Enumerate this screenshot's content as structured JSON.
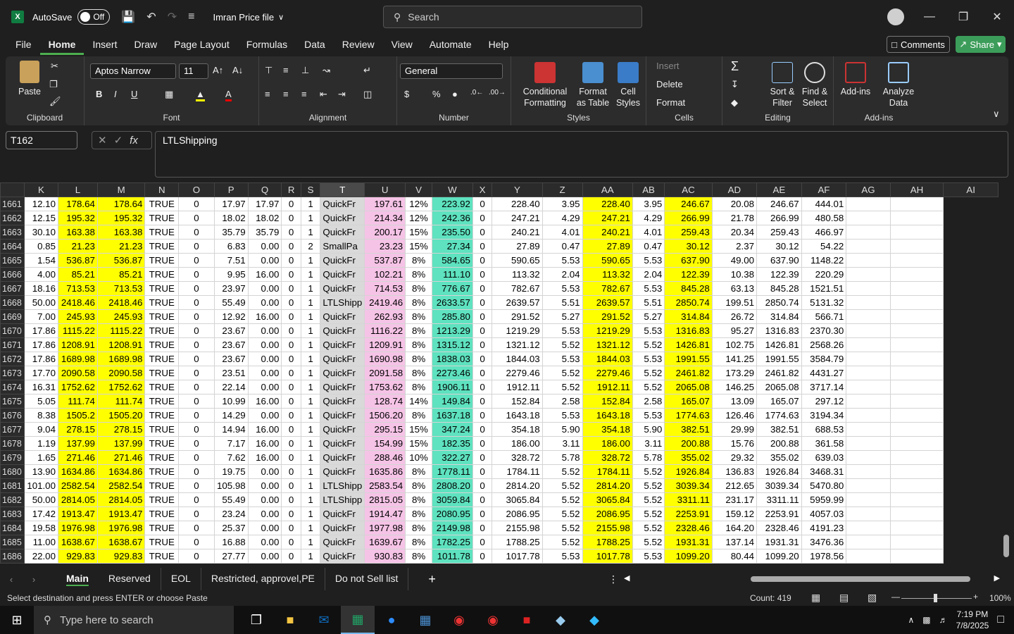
{
  "titlebar": {
    "autosave_label": "AutoSave",
    "toggle_state": "Off",
    "filename": "Imran Price file",
    "search_placeholder": "Search"
  },
  "menu": {
    "tabs": [
      "File",
      "Home",
      "Insert",
      "Draw",
      "Page Layout",
      "Formulas",
      "Data",
      "Review",
      "View",
      "Automate",
      "Help"
    ],
    "active": "Home",
    "comments": "Comments",
    "share": "Share"
  },
  "ribbon": {
    "clipboard": {
      "paste": "Paste",
      "label": "Clipboard"
    },
    "font": {
      "name": "Aptos Narrow",
      "size": "11",
      "label": "Font"
    },
    "alignment": {
      "label": "Alignment"
    },
    "number": {
      "format": "General",
      "label": "Number"
    },
    "styles": {
      "conditional": "Conditional Formatting",
      "format_table": "Format as Table",
      "cell_styles": "Cell Styles",
      "label": "Styles"
    },
    "cells": {
      "insert": "Insert",
      "delete": "Delete",
      "format": "Format",
      "label": "Cells"
    },
    "editing": {
      "sort": "Sort & Filter",
      "find": "Find & Select",
      "label": "Editing"
    },
    "addins": {
      "addins": "Add-ins",
      "analyze": "Analyze Data",
      "label": "Add-ins"
    }
  },
  "formula_bar": {
    "name_box": "T162",
    "content": "LTLShipping"
  },
  "columns": [
    "K",
    "L",
    "M",
    "N",
    "O",
    "P",
    "Q",
    "R",
    "S",
    "T",
    "U",
    "V",
    "W",
    "X",
    "Y",
    "Z",
    "AA",
    "AB",
    "AC",
    "AD",
    "AE",
    "AF",
    "AG",
    "AH",
    "AI"
  ],
  "rows": [
    [
      "1661",
      "12.10",
      "178.64",
      "178.64",
      "TRUE",
      "0",
      "17.97",
      "17.97",
      "0",
      "1",
      "QuickFr",
      "197.61",
      "12%",
      "223.92",
      "0",
      "228.40",
      "3.95",
      "228.40",
      "3.95",
      "246.67",
      "20.08",
      "246.67",
      "444.01"
    ],
    [
      "1662",
      "12.15",
      "195.32",
      "195.32",
      "TRUE",
      "0",
      "18.02",
      "18.02",
      "0",
      "1",
      "QuickFr",
      "214.34",
      "12%",
      "242.36",
      "0",
      "247.21",
      "4.29",
      "247.21",
      "4.29",
      "266.99",
      "21.78",
      "266.99",
      "480.58"
    ],
    [
      "1663",
      "30.10",
      "163.38",
      "163.38",
      "TRUE",
      "0",
      "35.79",
      "35.79",
      "0",
      "1",
      "QuickFr",
      "200.17",
      "15%",
      "235.50",
      "0",
      "240.21",
      "4.01",
      "240.21",
      "4.01",
      "259.43",
      "20.34",
      "259.43",
      "466.97"
    ],
    [
      "1664",
      "0.85",
      "21.23",
      "21.23",
      "TRUE",
      "0",
      "6.83",
      "0.00",
      "0",
      "2",
      "SmallPa",
      "23.23",
      "15%",
      "27.34",
      "0",
      "27.89",
      "0.47",
      "27.89",
      "0.47",
      "30.12",
      "2.37",
      "30.12",
      "54.22"
    ],
    [
      "1665",
      "1.54",
      "536.87",
      "536.87",
      "TRUE",
      "0",
      "7.51",
      "0.00",
      "0",
      "1",
      "QuickFr",
      "537.87",
      "8%",
      "584.65",
      "0",
      "590.65",
      "5.53",
      "590.65",
      "5.53",
      "637.90",
      "49.00",
      "637.90",
      "1148.22"
    ],
    [
      "1666",
      "4.00",
      "85.21",
      "85.21",
      "TRUE",
      "0",
      "9.95",
      "16.00",
      "0",
      "1",
      "QuickFr",
      "102.21",
      "8%",
      "111.10",
      "0",
      "113.32",
      "2.04",
      "113.32",
      "2.04",
      "122.39",
      "10.38",
      "122.39",
      "220.29"
    ],
    [
      "1667",
      "18.16",
      "713.53",
      "713.53",
      "TRUE",
      "0",
      "23.97",
      "0.00",
      "0",
      "1",
      "QuickFr",
      "714.53",
      "8%",
      "776.67",
      "0",
      "782.67",
      "5.53",
      "782.67",
      "5.53",
      "845.28",
      "63.13",
      "845.28",
      "1521.51"
    ],
    [
      "1668",
      "50.00",
      "2418.46",
      "2418.46",
      "TRUE",
      "0",
      "55.49",
      "0.00",
      "0",
      "1",
      "LTLShipp",
      "2419.46",
      "8%",
      "2633.57",
      "0",
      "2639.57",
      "5.51",
      "2639.57",
      "5.51",
      "2850.74",
      "199.51",
      "2850.74",
      "5131.32"
    ],
    [
      "1669",
      "7.00",
      "245.93",
      "245.93",
      "TRUE",
      "0",
      "12.92",
      "16.00",
      "0",
      "1",
      "QuickFr",
      "262.93",
      "8%",
      "285.80",
      "0",
      "291.52",
      "5.27",
      "291.52",
      "5.27",
      "314.84",
      "26.72",
      "314.84",
      "566.71"
    ],
    [
      "1670",
      "17.86",
      "1115.22",
      "1115.22",
      "TRUE",
      "0",
      "23.67",
      "0.00",
      "0",
      "1",
      "QuickFr",
      "1116.22",
      "8%",
      "1213.29",
      "0",
      "1219.29",
      "5.53",
      "1219.29",
      "5.53",
      "1316.83",
      "95.27",
      "1316.83",
      "2370.30"
    ],
    [
      "1671",
      "17.86",
      "1208.91",
      "1208.91",
      "TRUE",
      "0",
      "23.67",
      "0.00",
      "0",
      "1",
      "QuickFr",
      "1209.91",
      "8%",
      "1315.12",
      "0",
      "1321.12",
      "5.52",
      "1321.12",
      "5.52",
      "1426.81",
      "102.75",
      "1426.81",
      "2568.26"
    ],
    [
      "1672",
      "17.86",
      "1689.98",
      "1689.98",
      "TRUE",
      "0",
      "23.67",
      "0.00",
      "0",
      "1",
      "QuickFr",
      "1690.98",
      "8%",
      "1838.03",
      "0",
      "1844.03",
      "5.53",
      "1844.03",
      "5.53",
      "1991.55",
      "141.25",
      "1991.55",
      "3584.79"
    ],
    [
      "1673",
      "17.70",
      "2090.58",
      "2090.58",
      "TRUE",
      "0",
      "23.51",
      "0.00",
      "0",
      "1",
      "QuickFr",
      "2091.58",
      "8%",
      "2273.46",
      "0",
      "2279.46",
      "5.52",
      "2279.46",
      "5.52",
      "2461.82",
      "173.29",
      "2461.82",
      "4431.27"
    ],
    [
      "1674",
      "16.31",
      "1752.62",
      "1752.62",
      "TRUE",
      "0",
      "22.14",
      "0.00",
      "0",
      "1",
      "QuickFr",
      "1753.62",
      "8%",
      "1906.11",
      "0",
      "1912.11",
      "5.52",
      "1912.11",
      "5.52",
      "2065.08",
      "146.25",
      "2065.08",
      "3717.14"
    ],
    [
      "1675",
      "5.05",
      "111.74",
      "111.74",
      "TRUE",
      "0",
      "10.99",
      "16.00",
      "0",
      "1",
      "QuickFr",
      "128.74",
      "14%",
      "149.84",
      "0",
      "152.84",
      "2.58",
      "152.84",
      "2.58",
      "165.07",
      "13.09",
      "165.07",
      "297.12"
    ],
    [
      "1676",
      "8.38",
      "1505.2",
      "1505.20",
      "TRUE",
      "0",
      "14.29",
      "0.00",
      "0",
      "1",
      "QuickFr",
      "1506.20",
      "8%",
      "1637.18",
      "0",
      "1643.18",
      "5.53",
      "1643.18",
      "5.53",
      "1774.63",
      "126.46",
      "1774.63",
      "3194.34"
    ],
    [
      "1677",
      "9.04",
      "278.15",
      "278.15",
      "TRUE",
      "0",
      "14.94",
      "16.00",
      "0",
      "1",
      "QuickFr",
      "295.15",
      "15%",
      "347.24",
      "0",
      "354.18",
      "5.90",
      "354.18",
      "5.90",
      "382.51",
      "29.99",
      "382.51",
      "688.53"
    ],
    [
      "1678",
      "1.19",
      "137.99",
      "137.99",
      "TRUE",
      "0",
      "7.17",
      "16.00",
      "0",
      "1",
      "QuickFr",
      "154.99",
      "15%",
      "182.35",
      "0",
      "186.00",
      "3.11",
      "186.00",
      "3.11",
      "200.88",
      "15.76",
      "200.88",
      "361.58"
    ],
    [
      "1679",
      "1.65",
      "271.46",
      "271.46",
      "TRUE",
      "0",
      "7.62",
      "16.00",
      "0",
      "1",
      "QuickFr",
      "288.46",
      "10%",
      "322.27",
      "0",
      "328.72",
      "5.78",
      "328.72",
      "5.78",
      "355.02",
      "29.32",
      "355.02",
      "639.03"
    ],
    [
      "1680",
      "13.90",
      "1634.86",
      "1634.86",
      "TRUE",
      "0",
      "19.75",
      "0.00",
      "0",
      "1",
      "QuickFr",
      "1635.86",
      "8%",
      "1778.11",
      "0",
      "1784.11",
      "5.52",
      "1784.11",
      "5.52",
      "1926.84",
      "136.83",
      "1926.84",
      "3468.31"
    ],
    [
      "1681",
      "101.00",
      "2582.54",
      "2582.54",
      "TRUE",
      "0",
      "105.98",
      "0.00",
      "0",
      "1",
      "LTLShipp",
      "2583.54",
      "8%",
      "2808.20",
      "0",
      "2814.20",
      "5.52",
      "2814.20",
      "5.52",
      "3039.34",
      "212.65",
      "3039.34",
      "5470.80"
    ],
    [
      "1682",
      "50.00",
      "2814.05",
      "2814.05",
      "TRUE",
      "0",
      "55.49",
      "0.00",
      "0",
      "1",
      "LTLShipp",
      "2815.05",
      "8%",
      "3059.84",
      "0",
      "3065.84",
      "5.52",
      "3065.84",
      "5.52",
      "3311.11",
      "231.17",
      "3311.11",
      "5959.99"
    ],
    [
      "1683",
      "17.42",
      "1913.47",
      "1913.47",
      "TRUE",
      "0",
      "23.24",
      "0.00",
      "0",
      "1",
      "QuickFr",
      "1914.47",
      "8%",
      "2080.95",
      "0",
      "2086.95",
      "5.52",
      "2086.95",
      "5.52",
      "2253.91",
      "159.12",
      "2253.91",
      "4057.03"
    ],
    [
      "1684",
      "19.58",
      "1976.98",
      "1976.98",
      "TRUE",
      "0",
      "25.37",
      "0.00",
      "0",
      "1",
      "QuickFr",
      "1977.98",
      "8%",
      "2149.98",
      "0",
      "2155.98",
      "5.52",
      "2155.98",
      "5.52",
      "2328.46",
      "164.20",
      "2328.46",
      "4191.23"
    ],
    [
      "1685",
      "11.00",
      "1638.67",
      "1638.67",
      "TRUE",
      "0",
      "16.88",
      "0.00",
      "0",
      "1",
      "QuickFr",
      "1639.67",
      "8%",
      "1782.25",
      "0",
      "1788.25",
      "5.52",
      "1788.25",
      "5.52",
      "1931.31",
      "137.14",
      "1931.31",
      "3476.36"
    ],
    [
      "1686",
      "22.00",
      "929.83",
      "929.83",
      "TRUE",
      "0",
      "27.77",
      "0.00",
      "0",
      "1",
      "QuickFr",
      "930.83",
      "8%",
      "1011.78",
      "0",
      "1017.78",
      "5.53",
      "1017.78",
      "5.53",
      "1099.20",
      "80.44",
      "1099.20",
      "1978.56"
    ]
  ],
  "sheets": [
    "Main",
    "Reserved",
    "EOL",
    "Restricted, approvel,PE",
    "Do not Sell list"
  ],
  "active_sheet": "Main",
  "status": {
    "message": "Select destination and press ENTER or choose Paste",
    "count": "Count: 419",
    "zoom": "100%"
  },
  "taskbar": {
    "search_placeholder": "Type here to search",
    "time": "7:19 PM",
    "date": "7/8/2025"
  },
  "colors": {
    "yellow": "#ffff00",
    "pink": "#f5c3e6",
    "teal": "#5ee2bf",
    "accent": "#107c41"
  }
}
